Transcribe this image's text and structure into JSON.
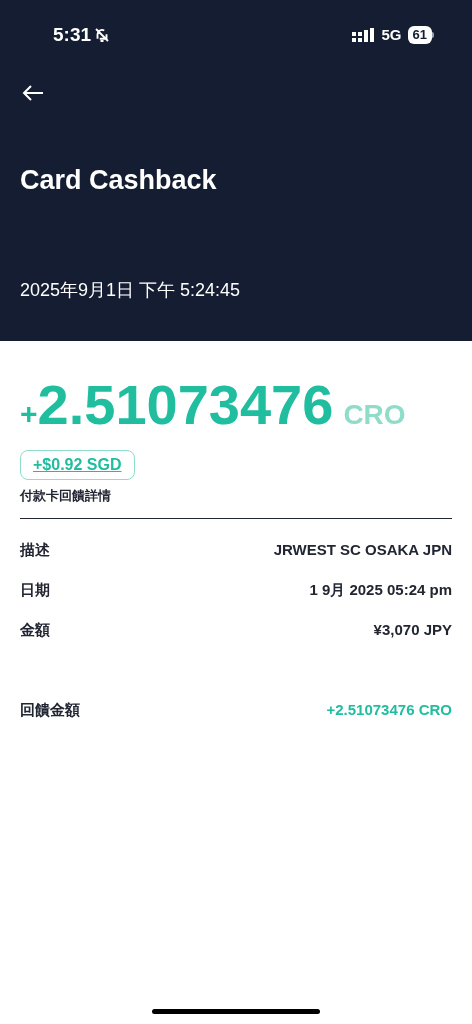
{
  "status_bar": {
    "time": "5:31",
    "network": "5G",
    "battery": "61"
  },
  "header": {
    "title": "Card Cashback",
    "timestamp": "2025年9月1日 下午 5:24:45"
  },
  "amount": {
    "sign": "+",
    "value": "2.51073476",
    "currency": "CRO",
    "fiat": "+$0.92 SGD"
  },
  "section_title": "付款卡回饋詳情",
  "details": [
    {
      "label": "描述",
      "value": "JRWEST SC OSAKA JPN",
      "kind": "plain"
    },
    {
      "label": "日期",
      "value": "1 9月 2025 05:24 pm",
      "kind": "plain"
    },
    {
      "label": "金額",
      "value": "¥3,070 JPY",
      "kind": "plain"
    },
    {
      "label": "回饋金額",
      "value": "+2.51073476 CRO",
      "kind": "highlight"
    }
  ]
}
